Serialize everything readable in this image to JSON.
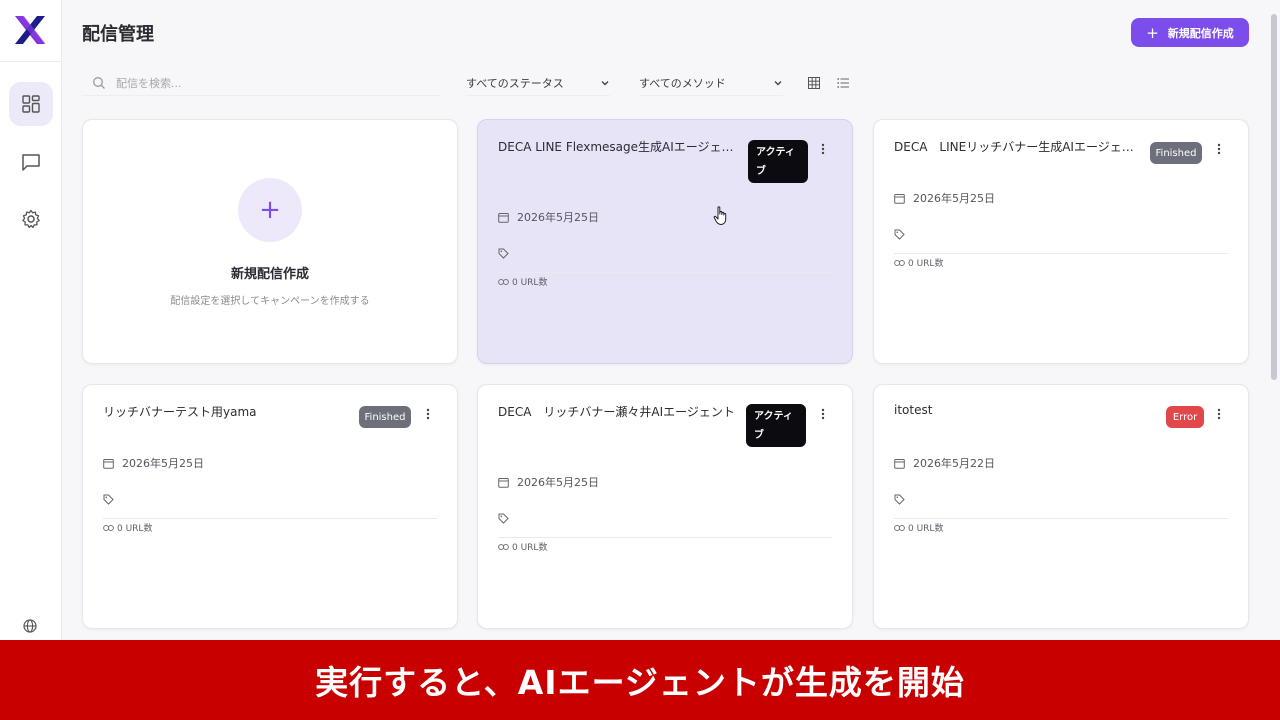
{
  "app": {
    "logo_icon": "x-logo-icon",
    "brand_color": "#7c4dea",
    "globe_icon": "globe-icon"
  },
  "sidebar": {
    "items": [
      {
        "name": "dashboard",
        "icon": "grid-icon",
        "active": true
      },
      {
        "name": "chat",
        "icon": "message-icon",
        "active": false
      },
      {
        "name": "settings",
        "icon": "gear-icon",
        "active": false
      }
    ]
  },
  "header": {
    "title": "配信管理",
    "new_button_icon": "+",
    "new_button_label": "新規配信作成"
  },
  "filters": {
    "search_placeholder": "配信を検索...",
    "status_value": "すべてのステータス",
    "method_value": "すべてのメソッド",
    "view_modes": [
      "grid",
      "list"
    ],
    "active_view": "grid"
  },
  "create_card": {
    "plus": "+",
    "title": "新規配信作成",
    "subtitle": "配信設定を選択してキャンペーンを作成する"
  },
  "cards": [
    {
      "title": "DECA LINE Flexmesage生成AIエージェント",
      "status": "アクティブ",
      "status_type": "active",
      "date": "2026年5月25日",
      "urls": "0 URL数"
    },
    {
      "title": "DECA　LINEリッチバナー生成AIエージェント",
      "status": "Finished",
      "status_type": "finished",
      "date": "2026年5月25日",
      "urls": "0 URL数"
    },
    {
      "title": "リッチバナーテスト用yama",
      "status": "Finished",
      "status_type": "finished",
      "date": "2026年5月25日",
      "urls": "0 URL数"
    },
    {
      "title": "DECA　リッチバナー瀬々井AIエージェント",
      "status": "アクティブ",
      "status_type": "active",
      "date": "2026年5月25日",
      "urls": "0 URL数"
    },
    {
      "title": "itotest",
      "status": "Error",
      "status_type": "error",
      "date": "2026年5月22日",
      "urls": "0 URL数"
    }
  ],
  "caption": "実行すると、AIエージェントが生成を開始",
  "colors": {
    "caption_bg": "#c80000",
    "active_badge": "#0b0b10",
    "finished_badge": "#6d707a",
    "error_badge": "#e0484a",
    "hover_card": "#e7e4f7"
  }
}
